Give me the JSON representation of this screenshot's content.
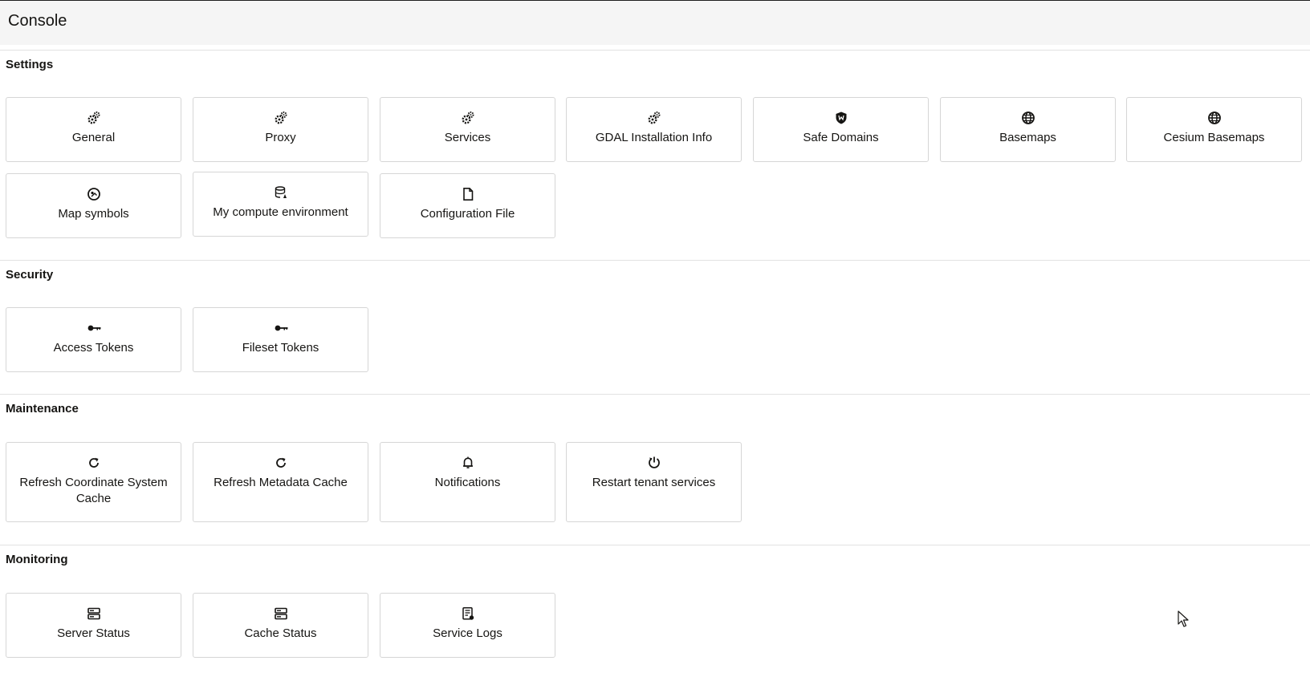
{
  "header": {
    "title": "Console"
  },
  "sections": {
    "settings": {
      "title": "Settings",
      "tiles": [
        {
          "label": "General",
          "icon": "gears-icon"
        },
        {
          "label": "Proxy",
          "icon": "gears-icon"
        },
        {
          "label": "Services",
          "icon": "gears-icon"
        },
        {
          "label": "GDAL Installation Info",
          "icon": "gears-icon"
        },
        {
          "label": "Safe Domains",
          "icon": "shield-icon"
        },
        {
          "label": "Basemaps",
          "icon": "globe-icon"
        },
        {
          "label": "Cesium Basemaps",
          "icon": "globe-icon"
        },
        {
          "label": "Map symbols",
          "icon": "map-symbol-icon"
        },
        {
          "label": "My compute environment",
          "icon": "database-icon"
        },
        {
          "label": "Configuration File",
          "icon": "file-icon"
        }
      ]
    },
    "security": {
      "title": "Security",
      "tiles": [
        {
          "label": "Access Tokens",
          "icon": "key-icon"
        },
        {
          "label": "Fileset Tokens",
          "icon": "key-icon"
        }
      ]
    },
    "maintenance": {
      "title": "Maintenance",
      "tiles": [
        {
          "label": "Refresh Coordinate System Cache",
          "icon": "refresh-icon"
        },
        {
          "label": "Refresh Metadata Cache",
          "icon": "refresh-icon"
        },
        {
          "label": "Notifications",
          "icon": "bell-icon"
        },
        {
          "label": "Restart tenant services",
          "icon": "power-icon"
        }
      ]
    },
    "monitoring": {
      "title": "Monitoring",
      "tiles": [
        {
          "label": "Server Status",
          "icon": "server-icon"
        },
        {
          "label": "Cache Status",
          "icon": "server-icon"
        },
        {
          "label": "Service Logs",
          "icon": "log-icon"
        }
      ]
    }
  },
  "colors": {
    "header_bg": "#f5f5f5",
    "tile_border": "#d6d6d6",
    "text": "#161513"
  }
}
